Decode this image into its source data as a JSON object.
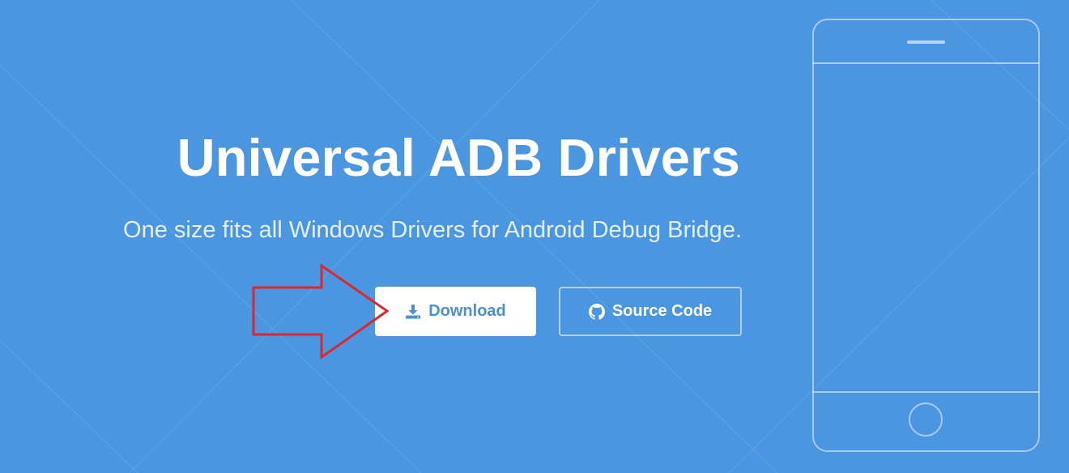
{
  "hero": {
    "title": "Universal ADB Drivers",
    "subtitle": "One size fits all Windows Drivers for Android Debug Bridge."
  },
  "buttons": {
    "download_label": "Download",
    "download_icon": "download-icon",
    "source_label": "Source Code",
    "source_icon": "github-icon"
  },
  "colors": {
    "background": "#4a96e0",
    "button_text": "#4a90d9",
    "annotation_arrow": "#e0262c"
  }
}
